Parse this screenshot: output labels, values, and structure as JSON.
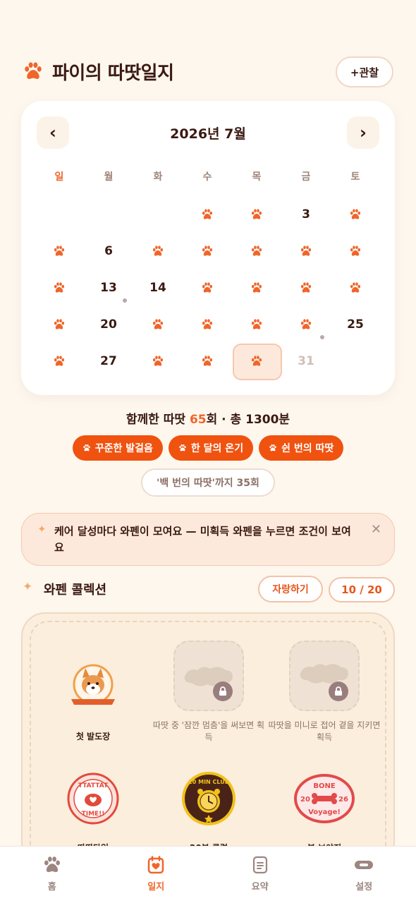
{
  "header": {
    "title": "파이의 따땃일지",
    "observe_label": "+관찰"
  },
  "calendar": {
    "title": "2026년 7월",
    "prev_label": "‹",
    "next_label": "›",
    "weekdays": [
      "일",
      "월",
      "화",
      "수",
      "목",
      "금",
      "토"
    ],
    "days": [
      {
        "day": 1,
        "paw": true
      },
      {
        "day": 2,
        "paw": true
      },
      {
        "day": 3,
        "paw": false
      },
      {
        "day": 4,
        "paw": true
      },
      {
        "day": 5,
        "paw": true
      },
      {
        "day": 6,
        "paw": false
      },
      {
        "day": 7,
        "paw": true
      },
      {
        "day": 8,
        "paw": true
      },
      {
        "day": 9,
        "paw": true
      },
      {
        "day": 10,
        "paw": true
      },
      {
        "day": 11,
        "paw": true
      },
      {
        "day": 12,
        "paw": true
      },
      {
        "day": 13,
        "paw": false
      },
      {
        "day": 14,
        "paw": false,
        "dot": true
      },
      {
        "day": 15,
        "paw": true
      },
      {
        "day": 16,
        "paw": true
      },
      {
        "day": 17,
        "paw": true
      },
      {
        "day": 18,
        "paw": true
      },
      {
        "day": 19,
        "paw": true
      },
      {
        "day": 20,
        "paw": false
      },
      {
        "day": 21,
        "paw": true
      },
      {
        "day": 22,
        "paw": true
      },
      {
        "day": 23,
        "paw": true
      },
      {
        "day": 24,
        "paw": true
      },
      {
        "day": 25,
        "paw": false,
        "dot": true
      },
      {
        "day": 26,
        "paw": true
      },
      {
        "day": 27,
        "paw": false
      },
      {
        "day": 28,
        "paw": true
      },
      {
        "day": 29,
        "paw": true
      },
      {
        "day": 30,
        "paw": true,
        "today": true
      },
      {
        "day": 31,
        "paw": false,
        "future": true
      }
    ]
  },
  "summary": {
    "prefix": "함께한 따땃 ",
    "count": "65",
    "suffix": "회 · 총 1300분"
  },
  "badges": [
    "꾸준한 발걸음",
    "한 달의 온기",
    "쉰 번의 따땃"
  ],
  "milestone": "'백 번의 따땃'까지 35회",
  "notice": {
    "text": "케어 달성마다 와펜이 모여요 — 미획득 와펜을 누르면 조건이 보여요",
    "close": "✕"
  },
  "collection": {
    "title": "와펜 콜렉션",
    "brag_label": "자랑하기",
    "count": "10 / 20",
    "stickers": [
      {
        "name": "첫 발도장",
        "locked": false,
        "art_text": "FIRST PAW"
      },
      {
        "name": "따땃 중 '잠깐 멈춤'을 써보면 획득",
        "locked": true
      },
      {
        "name": "따땃을 미니로 접어 곁을 지키면 획득",
        "locked": true
      },
      {
        "name": "따땃타임",
        "locked": false,
        "art_text_top": "TTATTAT",
        "art_text_bottom": "TIME!!"
      },
      {
        "name": "20분 클럽",
        "locked": false,
        "art_text": "20 MIN CLUB"
      },
      {
        "name": "본 보야지",
        "locked": false,
        "art_text_top": "BONE",
        "art_text_mid_left": "20",
        "art_text_mid_right": "26",
        "art_text_bottom": "Voyage!"
      }
    ]
  },
  "tabbar": {
    "home": "홈",
    "journal": "일지",
    "summary": "요약",
    "settings": "설정"
  },
  "colors": {
    "accent": "#f0652a",
    "background": "#fdf7ee",
    "text": "#3b1a12"
  }
}
